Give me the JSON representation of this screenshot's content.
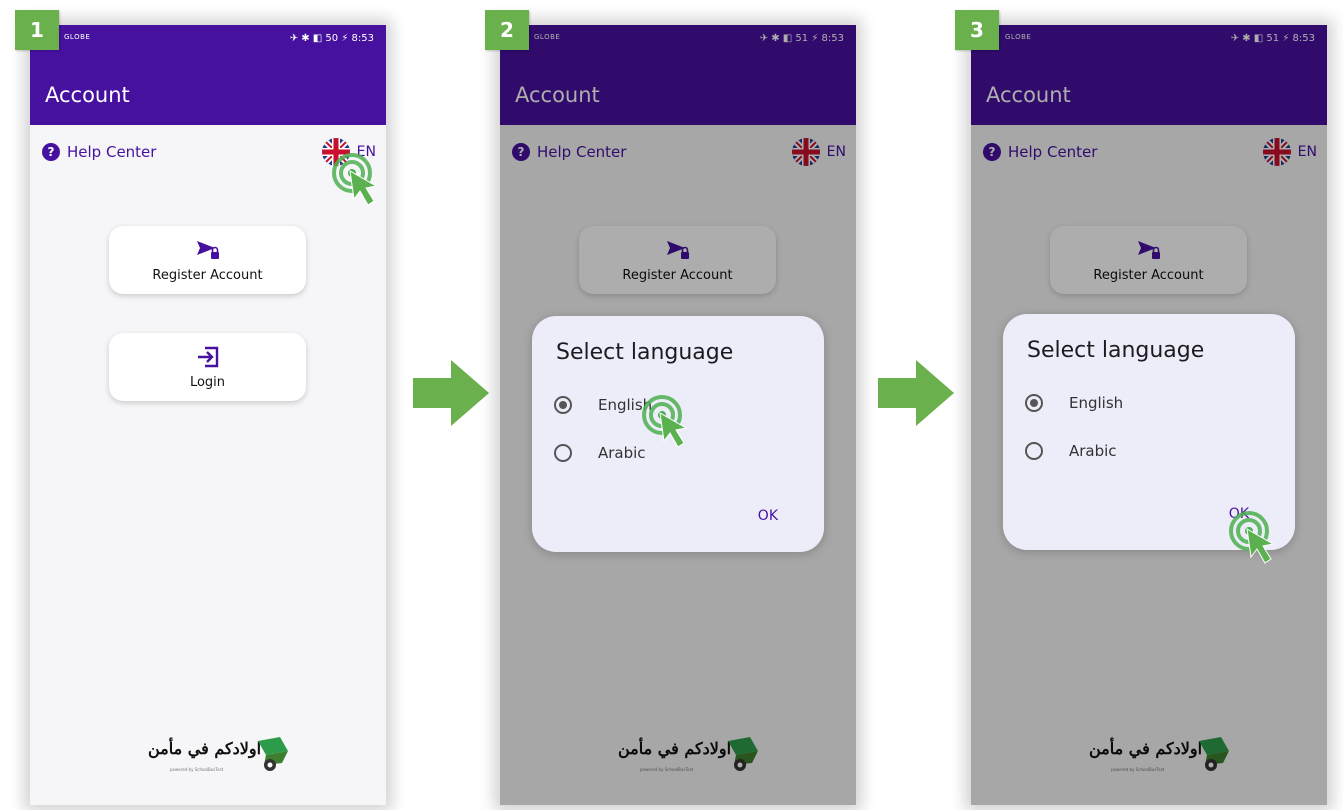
{
  "screens": [
    {
      "step": "1",
      "status_left": "GLOBE",
      "status_right": "✈ ✱ ◧ 50 ⚡ 8:53",
      "title": "Account",
      "help_label": "Help Center",
      "lang_code": "EN",
      "register_label": "Register Account",
      "login_label": "Login",
      "brand_text": "اولادكم في مأمن",
      "brand_sub": "powered by SchoolBusTest"
    },
    {
      "step": "2",
      "status_left": "GLOBE",
      "status_right": "✈ ✱ ◧ 51 ⚡ 8:53",
      "title": "Account",
      "help_label": "Help Center",
      "lang_code": "EN",
      "register_label": "Register Account",
      "dialog_title": "Select language",
      "option_english": "English",
      "option_arabic": "Arabic",
      "ok_label": "OK",
      "brand_text": "اولادكم في مأمن",
      "brand_sub": "powered by SchoolBusTest"
    },
    {
      "step": "3",
      "status_left": "GLOBE",
      "status_right": "✈ ✱ ◧ 51 ⚡ 8:53",
      "title": "Account",
      "help_label": "Help Center",
      "lang_code": "EN",
      "register_label": "Register Account",
      "dialog_title": "Select language",
      "option_english": "English",
      "option_arabic": "Arabic",
      "ok_label": "OK",
      "brand_text": "اولادكم في مأمن",
      "brand_sub": "powered by SchoolBusTest"
    }
  ],
  "colors": {
    "appbar": "#47119f",
    "step_badge": "#6ab04c",
    "arrow": "#6ab04c",
    "tap_indicator": "#4caf50"
  },
  "icons": {
    "help": "help-circle-icon",
    "flag": "uk-flag-icon",
    "register": "send-lock-icon",
    "login": "login-icon",
    "tap": "tap-cursor-icon",
    "arrow": "right-arrow-icon"
  }
}
